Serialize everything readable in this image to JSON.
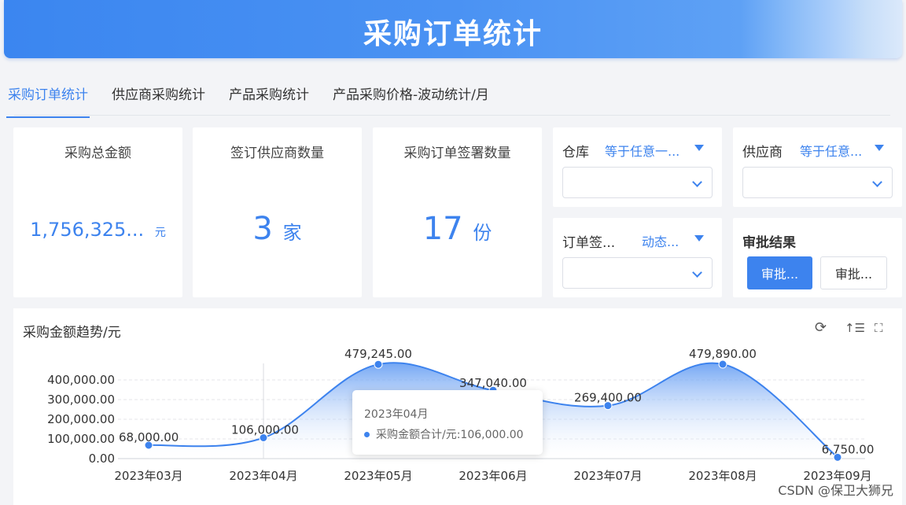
{
  "banner": {
    "title": "采购订单统计"
  },
  "tabs": [
    "采购订单统计",
    "供应商采购统计",
    "产品采购统计",
    "产品采购价格-波动统计/月"
  ],
  "stats": [
    {
      "label": "采购总金额",
      "value": "1,756,325...",
      "unit": "元"
    },
    {
      "label": "签订供应商数量",
      "value": "3",
      "unit": "家"
    },
    {
      "label": "采购订单签署数量",
      "value": "17",
      "unit": "份"
    }
  ],
  "filters": {
    "warehouse": {
      "label": "仓库",
      "mode": "等于任意一..."
    },
    "supplier": {
      "label": "供应商",
      "mode": "等于任意..."
    },
    "sign_date": {
      "label": "订单签...",
      "mode": "动态..."
    }
  },
  "approval": {
    "title": "审批结果",
    "btn_primary": "审批...",
    "btn_plain": "审批..."
  },
  "chart": {
    "title": "采购金额趋势/元"
  },
  "tooltip": {
    "title": "2023年04月",
    "row": "采购金额合计/元:106,000.00"
  },
  "watermark": "CSDN @保卫大狮兄",
  "chart_data": {
    "type": "area",
    "title": "采购金额趋势/元",
    "categories": [
      "2023年03月",
      "2023年04月",
      "2023年05月",
      "2023年06月",
      "2023年07月",
      "2023年08月",
      "2023年09月"
    ],
    "series": [
      {
        "name": "采购金额合计/元",
        "values": [
          68000,
          106000,
          479245,
          347040,
          269400,
          479890,
          6750
        ]
      }
    ],
    "value_labels": [
      "68,000.00",
      "106,000.00",
      "479,245.00",
      "347,040.00",
      "269,400.00",
      "479,890.00",
      "6,750.00"
    ],
    "ytick_labels": [
      "0.00",
      "100,000.00",
      "200,000.00",
      "300,000.00",
      "400,000.00"
    ],
    "ylim": [
      0,
      500000
    ],
    "grid": true,
    "color": "#3d83ee"
  }
}
